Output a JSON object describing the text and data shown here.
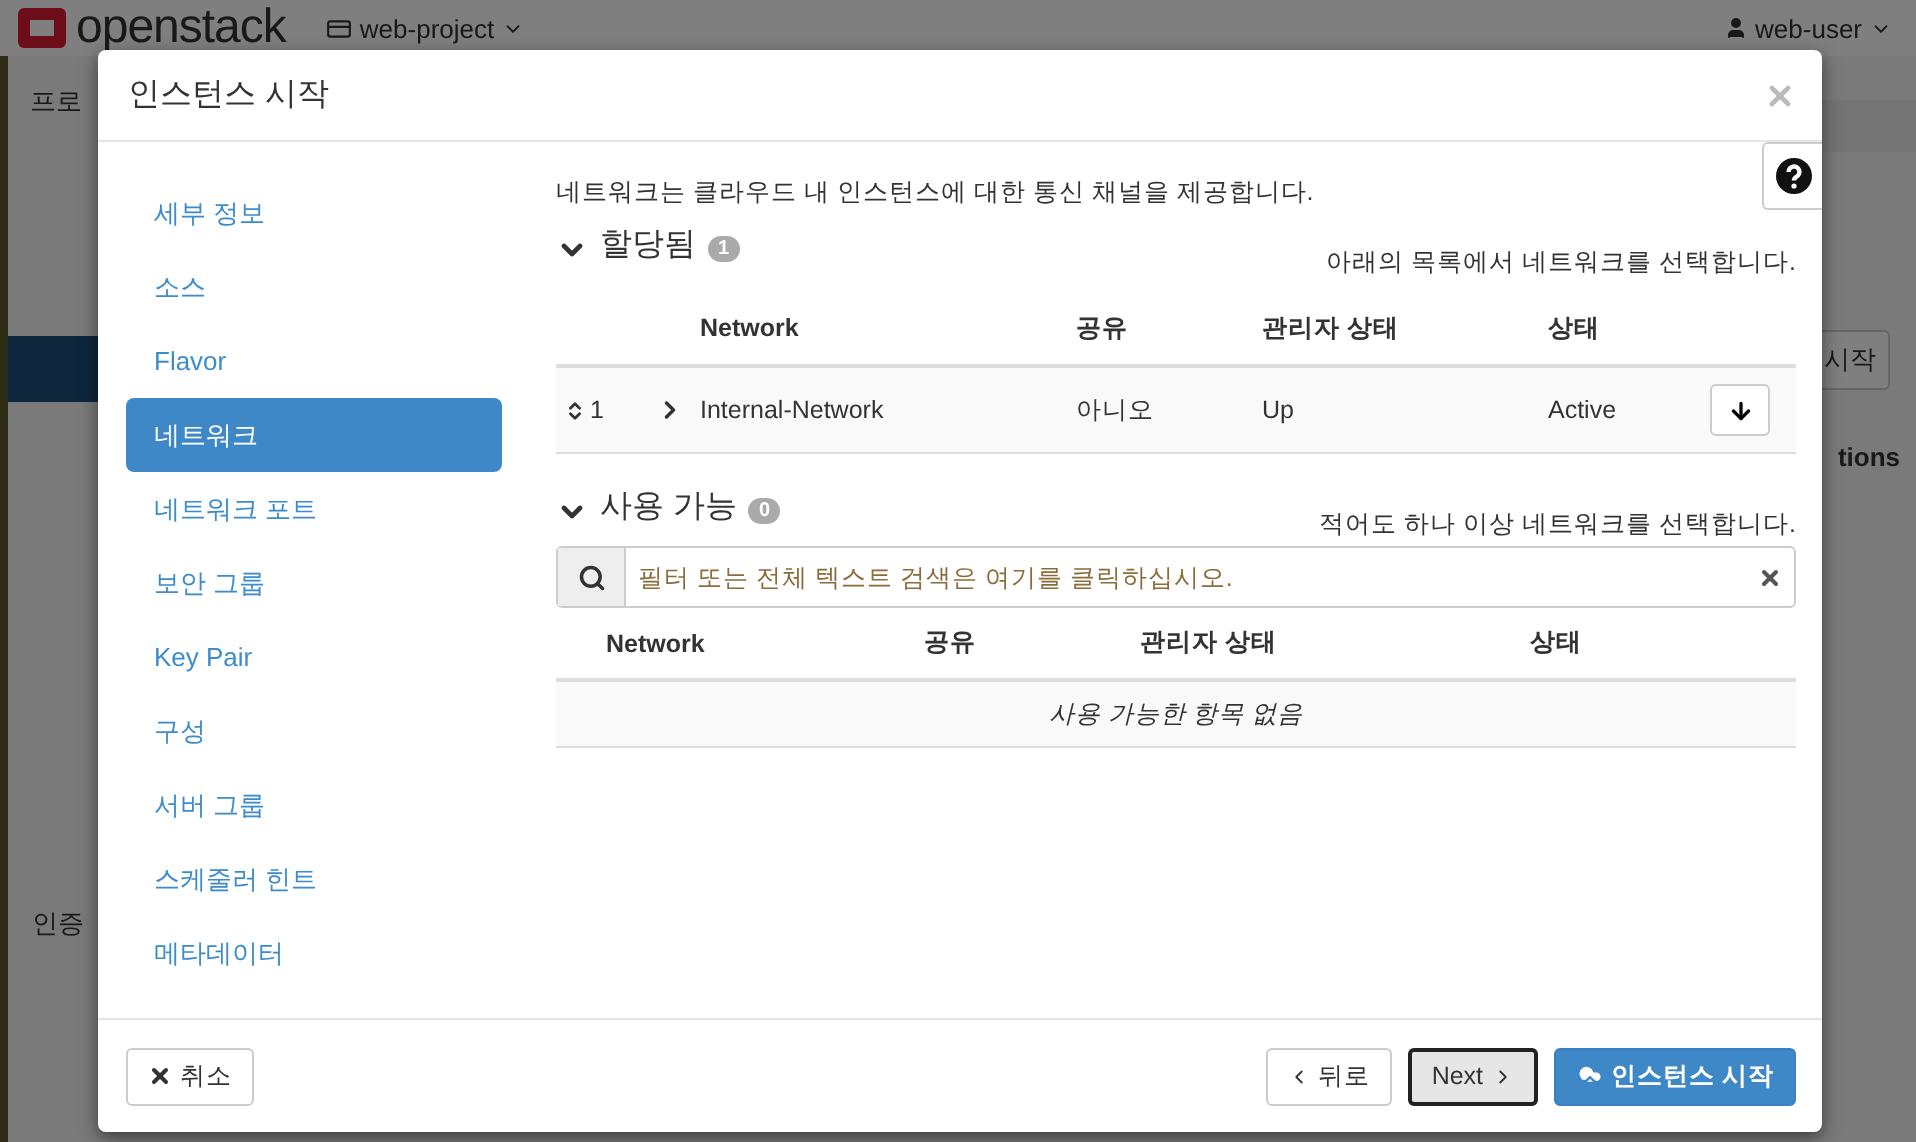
{
  "topbar": {
    "brand": "openstack",
    "project": "web-project",
    "user": "web-user"
  },
  "background": {
    "breadcrumb": "프로",
    "nav_label": "인증",
    "launch_button": "시작",
    "column_label": "tions"
  },
  "dialog": {
    "title": "인스턴스 시작",
    "steps": [
      {
        "label": "세부 정보",
        "selected": false
      },
      {
        "label": "소스",
        "selected": false
      },
      {
        "label": "Flavor",
        "selected": false
      },
      {
        "label": "네트워크",
        "selected": true
      },
      {
        "label": "네트워크 포트",
        "selected": false
      },
      {
        "label": "보안 그룹",
        "selected": false
      },
      {
        "label": "Key Pair",
        "selected": false
      },
      {
        "label": "구성",
        "selected": false
      },
      {
        "label": "서버 그룹",
        "selected": false
      },
      {
        "label": "스케줄러 힌트",
        "selected": false
      },
      {
        "label": "메타데이터",
        "selected": false
      }
    ],
    "intro": "네트워크는 클라우드 내 인스턴스에 대한 통신 채널을 제공합니다.",
    "allocated": {
      "title": "할당됨",
      "count": "1",
      "hint": "아래의 목록에서 네트워크를 선택합니다.",
      "columns": [
        "Network",
        "공유",
        "관리자 상태",
        "상태"
      ],
      "rows": [
        {
          "order": "1",
          "network": "Internal-Network",
          "shared": "아니오",
          "admin_state": "Up",
          "status": "Active"
        }
      ]
    },
    "available": {
      "title": "사용 가능",
      "count": "0",
      "hint": "적어도 하나 이상 네트워크를 선택합니다.",
      "search": {
        "placeholder": "필터 또는 전체 텍스트 검색은 여기를 클릭하십시오."
      },
      "columns": [
        "Network",
        "공유",
        "관리자 상태",
        "상태"
      ],
      "empty": "사용 가능한 항목 없음"
    },
    "footer": {
      "cancel": "취소",
      "back": "뒤로",
      "next": "Next",
      "launch": "인스턴스 시작"
    }
  }
}
